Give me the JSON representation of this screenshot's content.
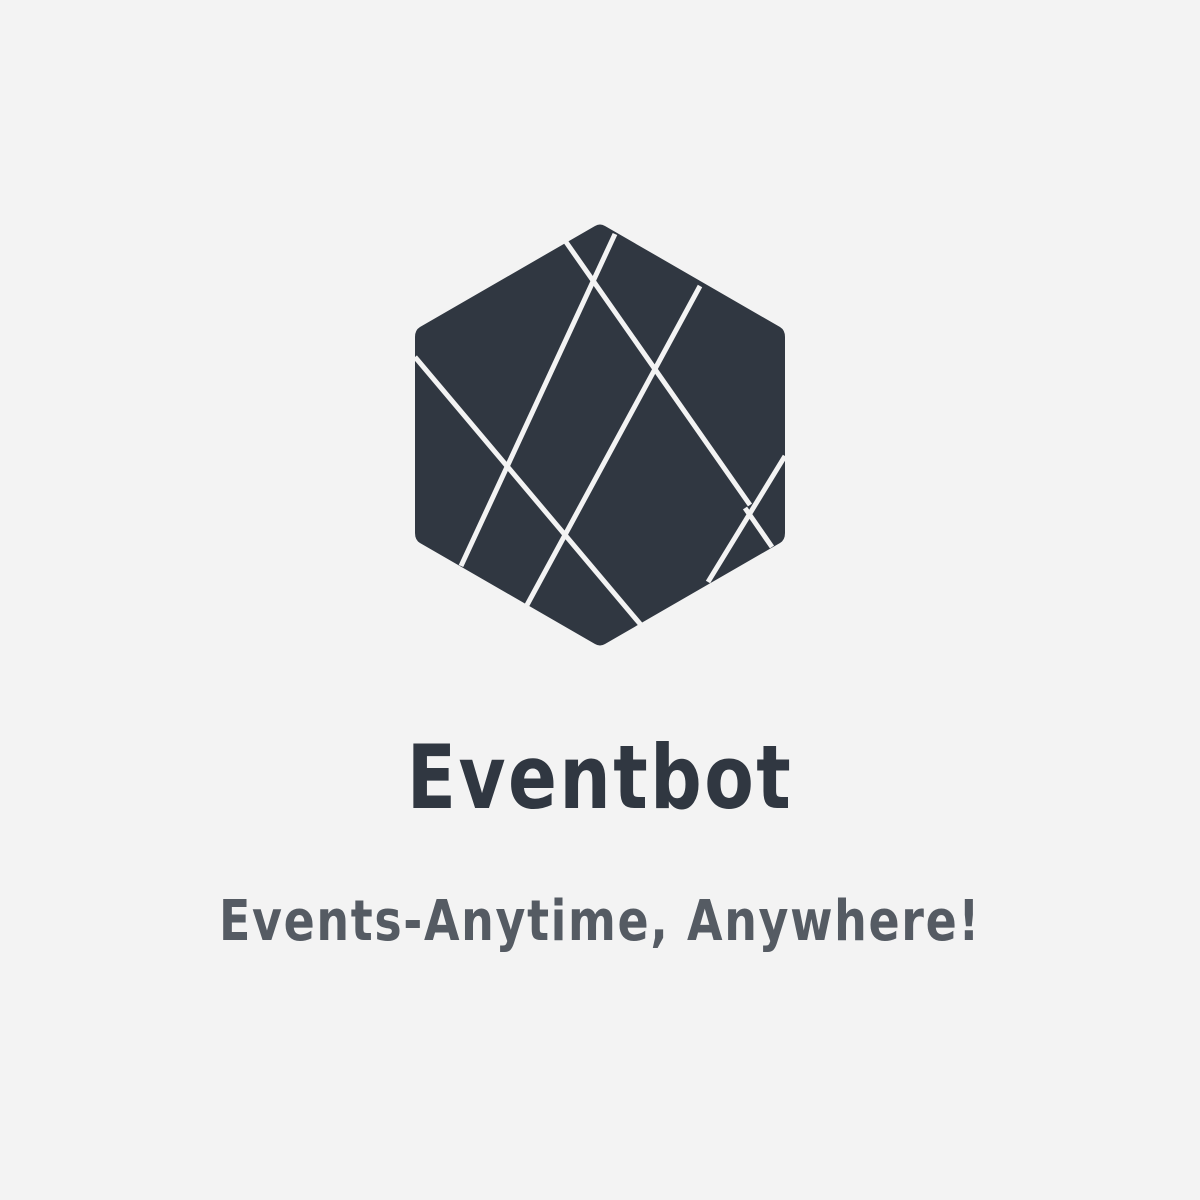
{
  "brand": {
    "name": "Eventbot",
    "tagline": "Events-Anytime, Anywhere!"
  },
  "logo": {
    "icon": "faceted-hexagon-icon"
  },
  "colors": {
    "background": "#f3f3f3",
    "logo_fill": "#303741",
    "logo_lines": "#f3f3f3",
    "name_text": "#303741",
    "tagline_text": "#555b63"
  }
}
